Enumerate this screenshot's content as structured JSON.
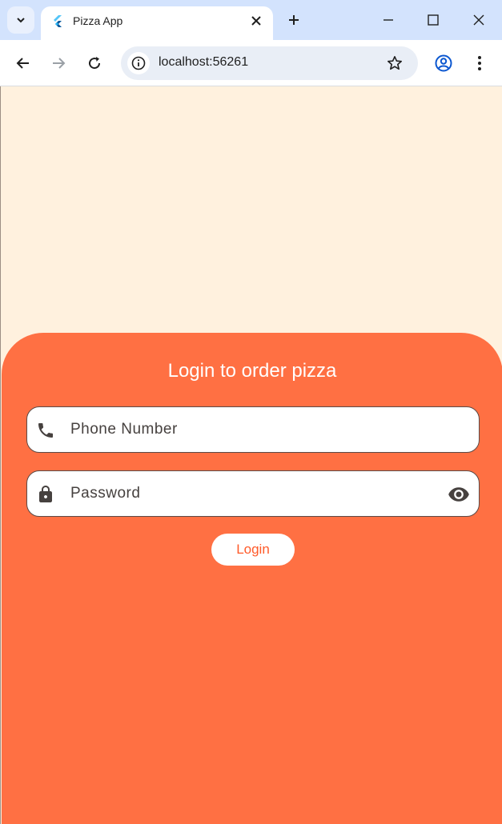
{
  "browser": {
    "tab_title": "Pizza App",
    "url": "localhost:56261",
    "icons": {
      "tab_search": "chevron-down-icon",
      "favicon": "flutter-icon",
      "tab_close": "close-icon",
      "new_tab": "plus-icon",
      "minimize": "minimize-icon",
      "maximize": "maximize-icon",
      "close_window": "close-icon",
      "back": "back-arrow-icon",
      "forward": "forward-arrow-icon",
      "reload": "reload-icon",
      "site_info": "info-icon",
      "bookmark": "star-icon",
      "profile": "profile-icon",
      "menu": "more-vert-icon"
    }
  },
  "login": {
    "heading": "Login to order pizza",
    "phone_placeholder": "Phone Number",
    "phone_value": "",
    "password_placeholder": "Password",
    "password_value": "",
    "button_label": "Login"
  },
  "colors": {
    "background": "#fff1de",
    "panel": "#ff7043",
    "accent_text": "#ff5a29",
    "tabstrip": "#d3e3fd"
  }
}
